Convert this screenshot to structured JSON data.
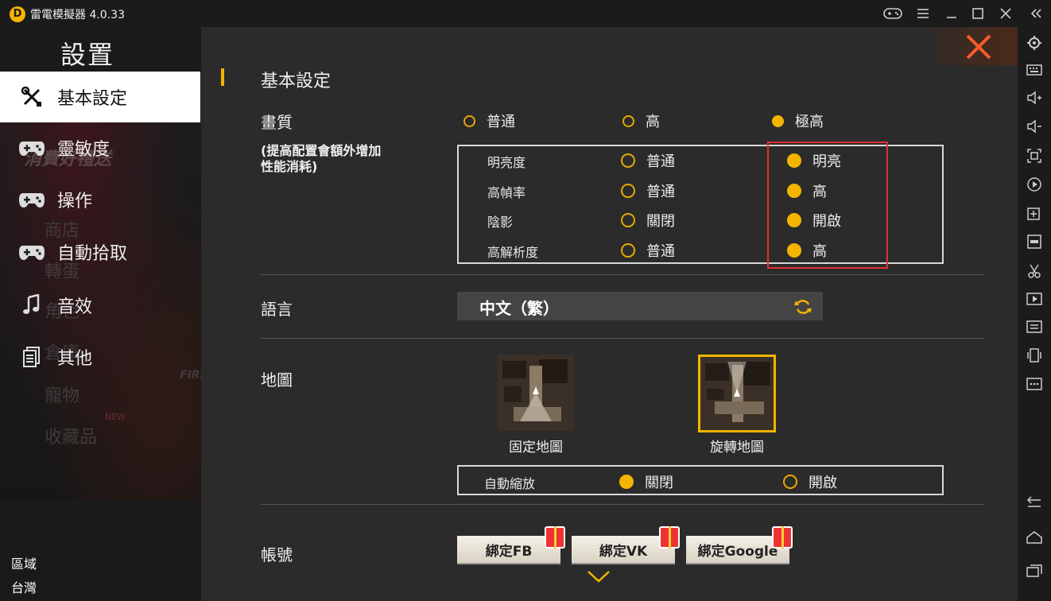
{
  "window": {
    "title": "雷電模擬器 4.0.33"
  },
  "sidebar": {
    "heading": "設置",
    "items": [
      {
        "label": "基本設定",
        "icon": "wrench-screwdriver-icon",
        "active": true
      },
      {
        "label": "靈敏度",
        "icon": "gamepad-icon"
      },
      {
        "label": "操作",
        "icon": "gamepad-icon"
      },
      {
        "label": "自動拾取",
        "icon": "gamepad-icon"
      },
      {
        "label": "音效",
        "icon": "music-note-icon"
      },
      {
        "label": "其他",
        "icon": "document-icon"
      }
    ],
    "background_text": [
      "消費好禮送",
      "商店",
      "轉蛋",
      "角色",
      "倉庫",
      "寵物",
      "收藏品",
      "NEW",
      "FIRE"
    ],
    "region_label": "區域",
    "region_value": "台灣"
  },
  "main": {
    "section_title": "基本設定",
    "quality": {
      "label": "畫質",
      "note": "(提高配置會額外增加\n性能消耗)",
      "options": [
        "普通",
        "高",
        "極高"
      ],
      "selected": "極高",
      "details": [
        {
          "name": "明亮度",
          "option_a": "普通",
          "option_b": "明亮",
          "selected": "明亮"
        },
        {
          "name": "高幀率",
          "option_a": "普通",
          "option_b": "高",
          "selected": "高"
        },
        {
          "name": "陰影",
          "option_a": "關閉",
          "option_b": "開啟",
          "selected": "開啟"
        },
        {
          "name": "高解析度",
          "option_a": "普通",
          "option_b": "高",
          "selected": "高"
        }
      ]
    },
    "language": {
      "label": "語言",
      "value": "中文（繁）"
    },
    "map": {
      "label": "地圖",
      "options": [
        "固定地圖",
        "旋轉地圖"
      ],
      "selected": "旋轉地圖",
      "auto_zoom": {
        "label": "自動縮放",
        "option_off": "關閉",
        "option_on": "開啟",
        "selected": "關閉"
      }
    },
    "account": {
      "label": "帳號",
      "buttons": [
        "綁定FB",
        "綁定VK",
        "綁定Google"
      ]
    }
  },
  "colors": {
    "accent": "#f5b400",
    "highlight_box": "#e03030",
    "close_x": "#ff5a2a"
  }
}
